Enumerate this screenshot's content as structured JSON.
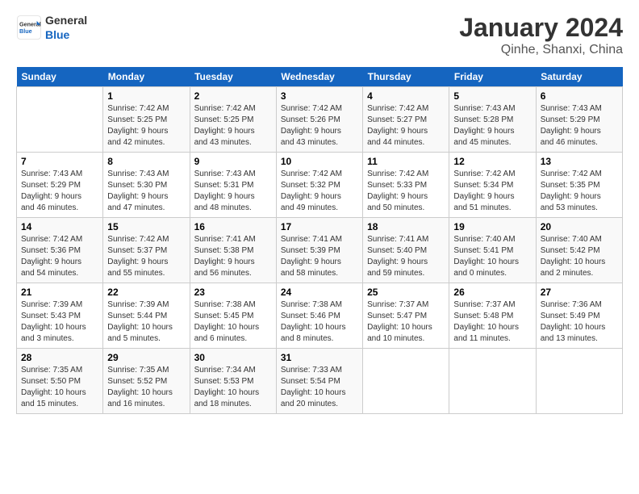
{
  "header": {
    "logo_line1": "General",
    "logo_line2": "Blue",
    "title": "January 2024",
    "subtitle": "Qinhe, Shanxi, China"
  },
  "columns": [
    "Sunday",
    "Monday",
    "Tuesday",
    "Wednesday",
    "Thursday",
    "Friday",
    "Saturday"
  ],
  "weeks": [
    [
      {
        "day": "",
        "info": ""
      },
      {
        "day": "1",
        "info": "Sunrise: 7:42 AM\nSunset: 5:25 PM\nDaylight: 9 hours\nand 42 minutes."
      },
      {
        "day": "2",
        "info": "Sunrise: 7:42 AM\nSunset: 5:25 PM\nDaylight: 9 hours\nand 43 minutes."
      },
      {
        "day": "3",
        "info": "Sunrise: 7:42 AM\nSunset: 5:26 PM\nDaylight: 9 hours\nand 43 minutes."
      },
      {
        "day": "4",
        "info": "Sunrise: 7:42 AM\nSunset: 5:27 PM\nDaylight: 9 hours\nand 44 minutes."
      },
      {
        "day": "5",
        "info": "Sunrise: 7:43 AM\nSunset: 5:28 PM\nDaylight: 9 hours\nand 45 minutes."
      },
      {
        "day": "6",
        "info": "Sunrise: 7:43 AM\nSunset: 5:29 PM\nDaylight: 9 hours\nand 46 minutes."
      }
    ],
    [
      {
        "day": "7",
        "info": "Sunrise: 7:43 AM\nSunset: 5:29 PM\nDaylight: 9 hours\nand 46 minutes."
      },
      {
        "day": "8",
        "info": "Sunrise: 7:43 AM\nSunset: 5:30 PM\nDaylight: 9 hours\nand 47 minutes."
      },
      {
        "day": "9",
        "info": "Sunrise: 7:43 AM\nSunset: 5:31 PM\nDaylight: 9 hours\nand 48 minutes."
      },
      {
        "day": "10",
        "info": "Sunrise: 7:42 AM\nSunset: 5:32 PM\nDaylight: 9 hours\nand 49 minutes."
      },
      {
        "day": "11",
        "info": "Sunrise: 7:42 AM\nSunset: 5:33 PM\nDaylight: 9 hours\nand 50 minutes."
      },
      {
        "day": "12",
        "info": "Sunrise: 7:42 AM\nSunset: 5:34 PM\nDaylight: 9 hours\nand 51 minutes."
      },
      {
        "day": "13",
        "info": "Sunrise: 7:42 AM\nSunset: 5:35 PM\nDaylight: 9 hours\nand 53 minutes."
      }
    ],
    [
      {
        "day": "14",
        "info": "Sunrise: 7:42 AM\nSunset: 5:36 PM\nDaylight: 9 hours\nand 54 minutes."
      },
      {
        "day": "15",
        "info": "Sunrise: 7:42 AM\nSunset: 5:37 PM\nDaylight: 9 hours\nand 55 minutes."
      },
      {
        "day": "16",
        "info": "Sunrise: 7:41 AM\nSunset: 5:38 PM\nDaylight: 9 hours\nand 56 minutes."
      },
      {
        "day": "17",
        "info": "Sunrise: 7:41 AM\nSunset: 5:39 PM\nDaylight: 9 hours\nand 58 minutes."
      },
      {
        "day": "18",
        "info": "Sunrise: 7:41 AM\nSunset: 5:40 PM\nDaylight: 9 hours\nand 59 minutes."
      },
      {
        "day": "19",
        "info": "Sunrise: 7:40 AM\nSunset: 5:41 PM\nDaylight: 10 hours\nand 0 minutes."
      },
      {
        "day": "20",
        "info": "Sunrise: 7:40 AM\nSunset: 5:42 PM\nDaylight: 10 hours\nand 2 minutes."
      }
    ],
    [
      {
        "day": "21",
        "info": "Sunrise: 7:39 AM\nSunset: 5:43 PM\nDaylight: 10 hours\nand 3 minutes."
      },
      {
        "day": "22",
        "info": "Sunrise: 7:39 AM\nSunset: 5:44 PM\nDaylight: 10 hours\nand 5 minutes."
      },
      {
        "day": "23",
        "info": "Sunrise: 7:38 AM\nSunset: 5:45 PM\nDaylight: 10 hours\nand 6 minutes."
      },
      {
        "day": "24",
        "info": "Sunrise: 7:38 AM\nSunset: 5:46 PM\nDaylight: 10 hours\nand 8 minutes."
      },
      {
        "day": "25",
        "info": "Sunrise: 7:37 AM\nSunset: 5:47 PM\nDaylight: 10 hours\nand 10 minutes."
      },
      {
        "day": "26",
        "info": "Sunrise: 7:37 AM\nSunset: 5:48 PM\nDaylight: 10 hours\nand 11 minutes."
      },
      {
        "day": "27",
        "info": "Sunrise: 7:36 AM\nSunset: 5:49 PM\nDaylight: 10 hours\nand 13 minutes."
      }
    ],
    [
      {
        "day": "28",
        "info": "Sunrise: 7:35 AM\nSunset: 5:50 PM\nDaylight: 10 hours\nand 15 minutes."
      },
      {
        "day": "29",
        "info": "Sunrise: 7:35 AM\nSunset: 5:52 PM\nDaylight: 10 hours\nand 16 minutes."
      },
      {
        "day": "30",
        "info": "Sunrise: 7:34 AM\nSunset: 5:53 PM\nDaylight: 10 hours\nand 18 minutes."
      },
      {
        "day": "31",
        "info": "Sunrise: 7:33 AM\nSunset: 5:54 PM\nDaylight: 10 hours\nand 20 minutes."
      },
      {
        "day": "",
        "info": ""
      },
      {
        "day": "",
        "info": ""
      },
      {
        "day": "",
        "info": ""
      }
    ]
  ]
}
